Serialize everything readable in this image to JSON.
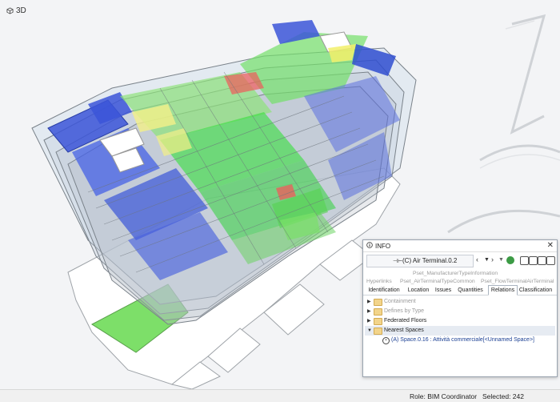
{
  "viewport": {
    "view_label": "3D"
  },
  "info_panel": {
    "title": "INFO",
    "object_name": "(C) Air Terminal.0.2",
    "pset_tabs": [
      "Pset_ManufacturerTypeInformation",
      "Hyperlinks",
      "Pset_AirTerminalTypeCommon",
      "Pset_FlowTerminalAirTerminal"
    ],
    "tabs": [
      "Identification",
      "Location",
      "Issues",
      "Quantities",
      "Relations",
      "Classification"
    ],
    "active_tab": "Relations",
    "tree": [
      {
        "label": "Containment",
        "dim": true
      },
      {
        "label": "Defines by Type",
        "dim": true
      },
      {
        "label": "Federated Floors",
        "dim": false
      },
      {
        "label": "Nearest Spaces",
        "dim": false,
        "expanded": true
      }
    ],
    "nearest_space": "(A) Space.0.16 : Attività commerciale[<Unnamed Space>]"
  },
  "status": {
    "role": "Role: BIM Coordinator",
    "selected": "Selected: 242"
  }
}
